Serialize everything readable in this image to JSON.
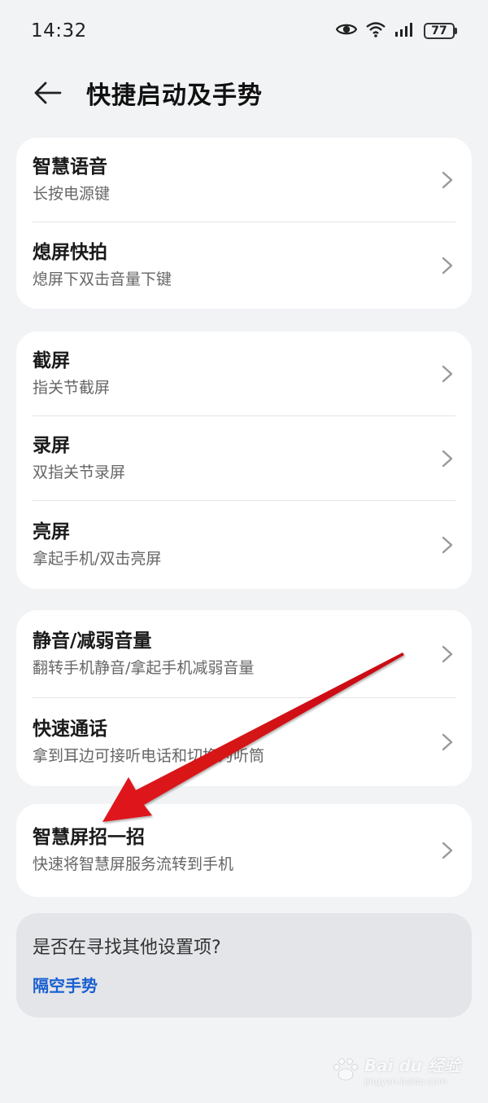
{
  "status_bar": {
    "time": "14:32",
    "battery": "77",
    "icons": [
      "eye-icon",
      "wifi-icon",
      "signal-icon",
      "battery-icon"
    ]
  },
  "header": {
    "title": "快捷启动及手势",
    "back_icon": "back-arrow-icon"
  },
  "groups": [
    {
      "items": [
        {
          "title": "智慧语音",
          "subtitle": "长按电源键"
        },
        {
          "title": "熄屏快拍",
          "subtitle": "熄屏下双击音量下键"
        }
      ]
    },
    {
      "items": [
        {
          "title": "截屏",
          "subtitle": "指关节截屏"
        },
        {
          "title": "录屏",
          "subtitle": "双指关节录屏"
        },
        {
          "title": "亮屏",
          "subtitle": "拿起手机/双击亮屏"
        }
      ]
    },
    {
      "items": [
        {
          "title": "静音/减弱音量",
          "subtitle": "翻转手机静音/拿起手机减弱音量"
        },
        {
          "title": "快速通话",
          "subtitle": "拿到耳边可接听电话和切换为听筒"
        }
      ]
    },
    {
      "items": [
        {
          "title": "智慧屏招一招",
          "subtitle": "快速将智慧屏服务流转到手机"
        }
      ]
    }
  ],
  "suggestion": {
    "question": "是否在寻找其他设置项?",
    "link": "隔空手势"
  },
  "watermark": {
    "brand": "Bai du 经验",
    "url": "jingyan.baidu.com"
  },
  "colors": {
    "background": "#f1f3f5",
    "card": "#ffffff",
    "link": "#1a5fd1",
    "annotation_arrow": "#e0151b"
  }
}
